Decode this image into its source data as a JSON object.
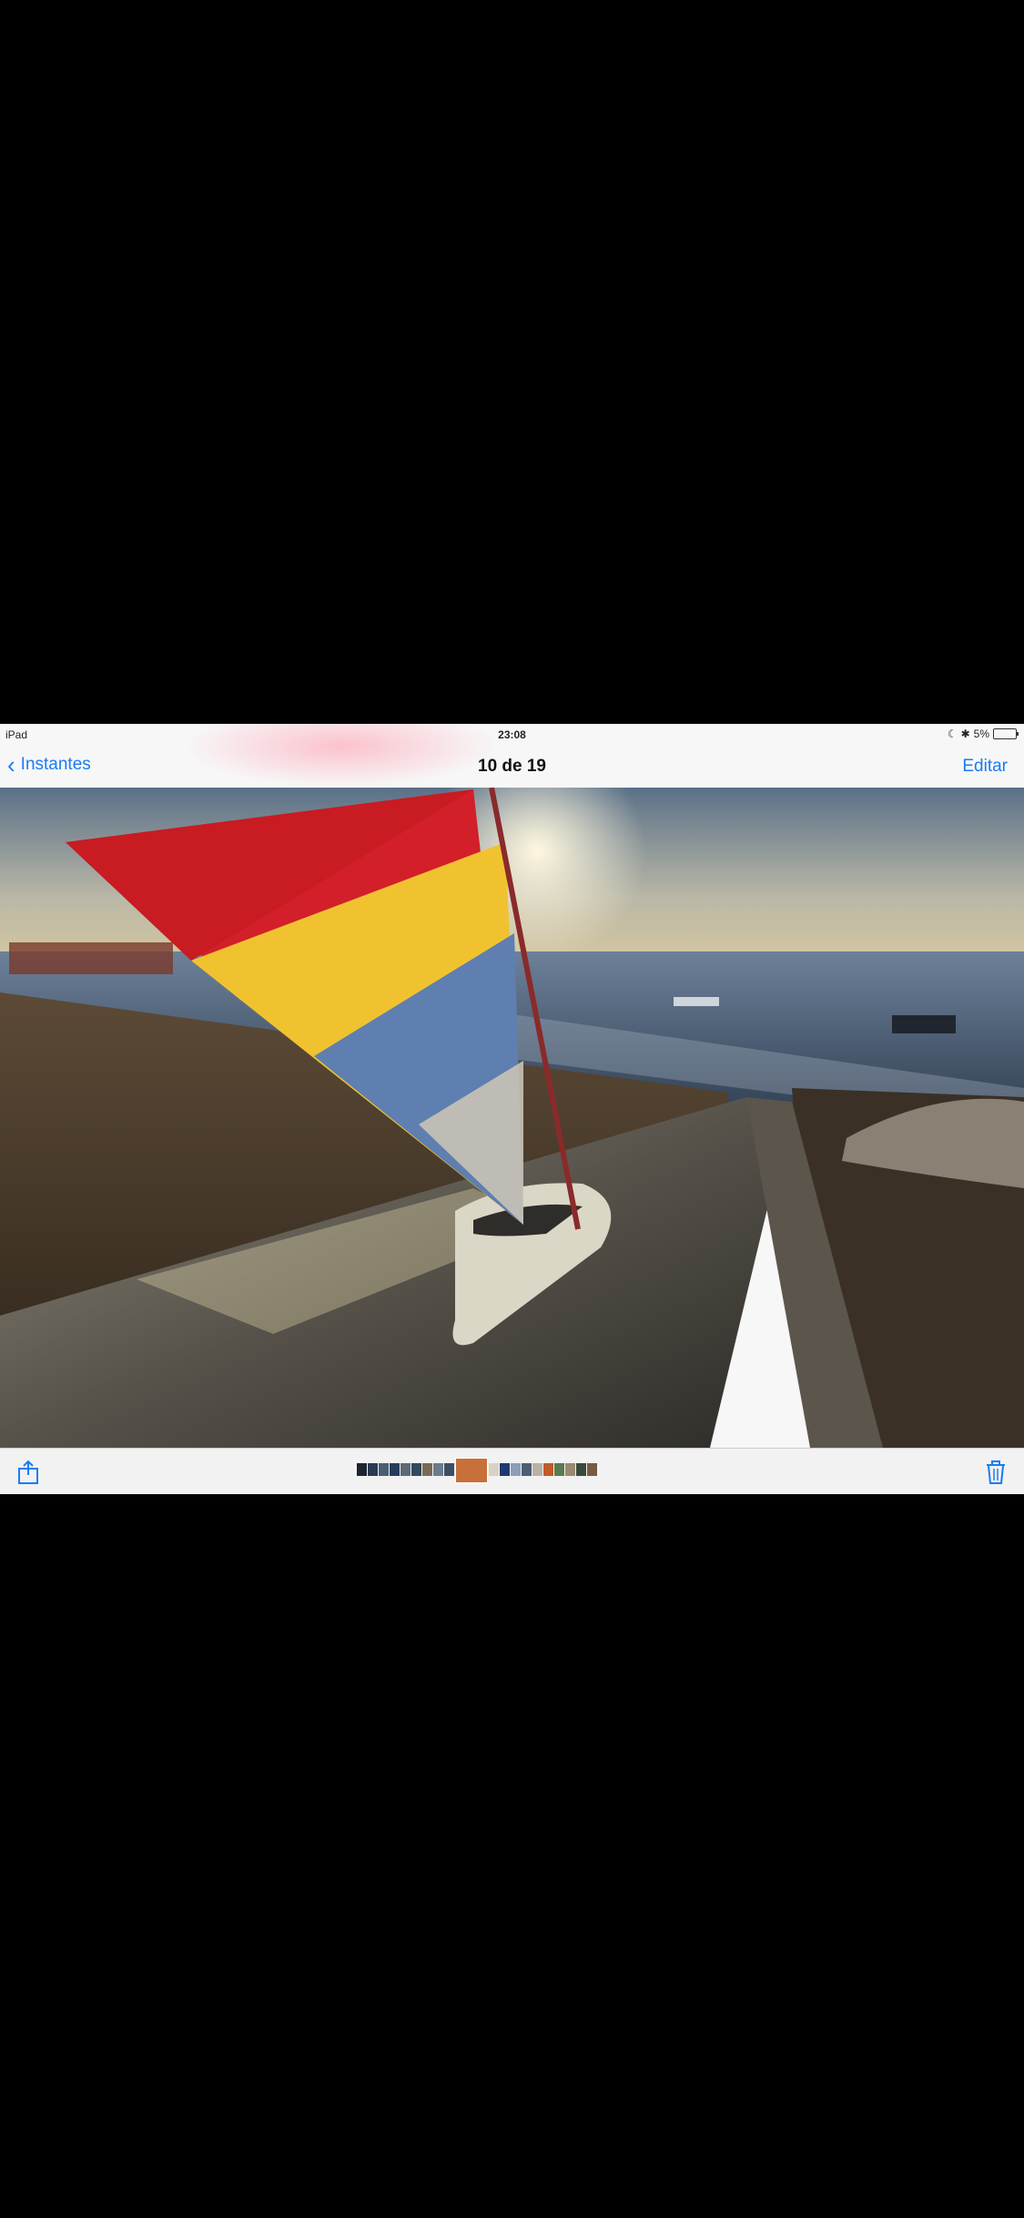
{
  "status": {
    "device": "iPad",
    "time": "23:08",
    "battery": "5%",
    "battery_level": 0.05
  },
  "nav": {
    "back_label": "Instantes",
    "title": "10 de 19",
    "edit_label": "Editar"
  },
  "accent": "#1a7cf5",
  "icons": {
    "back": "chevron-left-icon",
    "share": "share-icon",
    "trash": "trash-icon",
    "moon": "moon-icon",
    "bluetooth": "bluetooth-icon"
  },
  "filmstrip": {
    "selected_index": 9,
    "thumb_colors": [
      "#1b2430",
      "#2a3a52",
      "#4b5f74",
      "#263c5c",
      "#5d6a78",
      "#33475e",
      "#7a6a55",
      "#6b7b8c",
      "#3e4e60",
      "#c8703a",
      "#d9d2c0",
      "#1d3a72",
      "#8aa0b8",
      "#4e5e70",
      "#b8b2a4",
      "#c25a2a",
      "#5a7a50",
      "#9a8a70",
      "#3a4a3a",
      "#7a5a40"
    ]
  }
}
